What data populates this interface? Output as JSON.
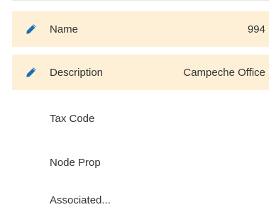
{
  "properties": [
    {
      "label": "Name",
      "value": "994",
      "editable": true,
      "icon": "pencil-icon"
    },
    {
      "label": "Description",
      "value": "Campeche Office",
      "editable": true,
      "icon": "pencil-icon"
    },
    {
      "label": "Tax Code",
      "value": "",
      "editable": false
    },
    {
      "label": "Node Prop",
      "value": "",
      "editable": false
    },
    {
      "label": "Associated...",
      "value": "",
      "editable": false
    }
  ],
  "colors": {
    "editable_row_bg": "#fdf0d6",
    "pencil_icon": "#1f6bb5",
    "text": "#333333"
  }
}
